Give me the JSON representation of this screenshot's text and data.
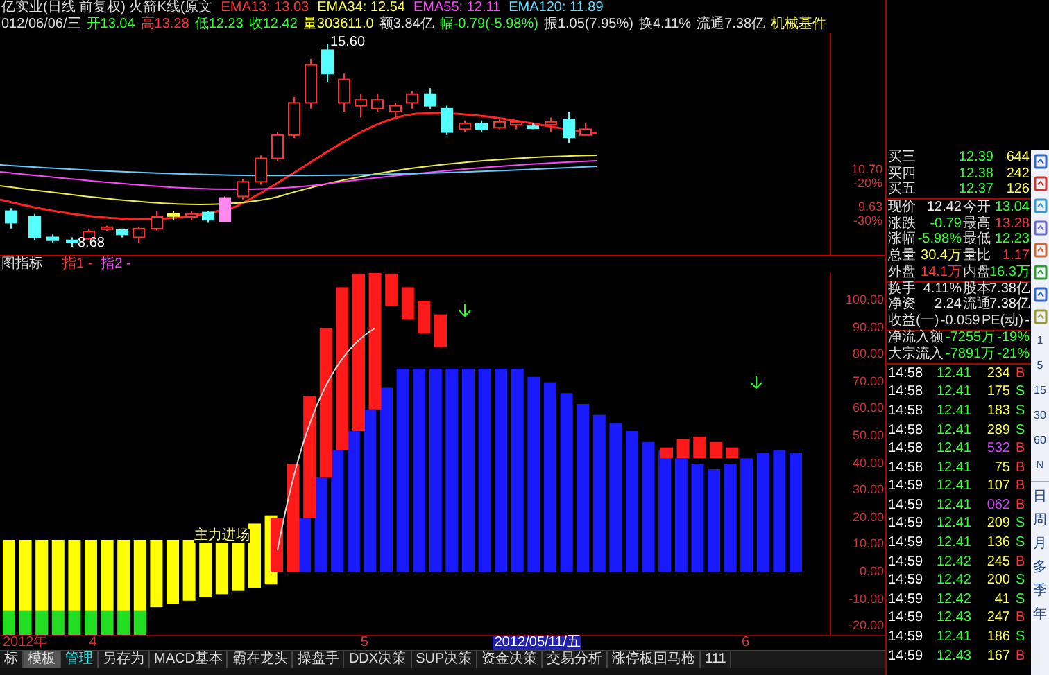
{
  "header": {
    "title": "亿实业(日线 前复权) 火箭K线(原文",
    "ema": [
      {
        "label": "EMA13: 13.03",
        "color": "#ff3333"
      },
      {
        "label": "EMA34: 12.54",
        "color": "#ffff55"
      },
      {
        "label": "EMA55: 12.11",
        "color": "#ff44ff"
      },
      {
        "label": "EMA120: 11.89",
        "color": "#66ddff"
      }
    ]
  },
  "quote_line": [
    {
      "text": "012/06/06/三",
      "color": "#dddddd"
    },
    {
      "text": "开13.04",
      "color": "#33ff33"
    },
    {
      "text": "高13.28",
      "color": "#ff3333"
    },
    {
      "text": "低12.23",
      "color": "#33ff33"
    },
    {
      "text": "收12.42",
      "color": "#33ff33"
    },
    {
      "text": "量303611.0",
      "color": "#ffff55"
    },
    {
      "text": "额3.84亿",
      "color": "#dddddd"
    },
    {
      "text": "幅-0.79(-5.98%)",
      "color": "#33ff33"
    },
    {
      "text": "振1.05(7.95%)",
      "color": "#dddddd"
    },
    {
      "text": "换4.11%",
      "color": "#dddddd"
    },
    {
      "text": "流通7.38亿",
      "color": "#dddddd"
    },
    {
      "text": "机械基件",
      "color": "#ffff55"
    }
  ],
  "price_chart": {
    "high_label": "15.60",
    "low_label": "8.68",
    "axis": [
      {
        "price": "10.70",
        "percent": "-20%"
      },
      {
        "price": "9.63",
        "percent": "-30%"
      }
    ]
  },
  "indicator": {
    "title": "图指标",
    "legend": [
      {
        "text": "指1 -",
        "color": "#ff3333"
      },
      {
        "text": "指2 -",
        "color": "#ff44ff"
      }
    ],
    "signal_label": "主力进场",
    "axis": [
      "100.00",
      "90.00",
      "80.00",
      "70.00",
      "60.00",
      "50.00",
      "40.00",
      "30.00",
      "20.00",
      "10.00",
      "0.00",
      "-10.00",
      "-20.00"
    ]
  },
  "date_axis": [
    {
      "text": "2012年",
      "selected": false
    },
    {
      "text": "4",
      "selected": false
    },
    {
      "text": "5",
      "selected": false
    },
    {
      "text": "2012/05/11/五",
      "selected": true
    },
    {
      "text": "6",
      "selected": false
    }
  ],
  "toolbar": [
    {
      "label": "标",
      "selected": false,
      "kind": "plain"
    },
    {
      "label": "模板",
      "selected": true,
      "kind": "plain"
    },
    {
      "label": "管理",
      "selected": false,
      "kind": "accent"
    },
    {
      "label": "另存为",
      "selected": false,
      "kind": "plain"
    },
    {
      "label": "MACD基本",
      "selected": false,
      "kind": "plain"
    },
    {
      "label": "霸在龙头",
      "selected": false,
      "kind": "plain"
    },
    {
      "label": "操盘手",
      "selected": false,
      "kind": "plain"
    },
    {
      "label": "DDX决策",
      "selected": false,
      "kind": "plain"
    },
    {
      "label": "SUP决策",
      "selected": false,
      "kind": "plain"
    },
    {
      "label": "资金决策",
      "selected": false,
      "kind": "plain"
    },
    {
      "label": "交易分析",
      "selected": false,
      "kind": "plain"
    },
    {
      "label": "涨停板回马枪",
      "selected": false,
      "kind": "plain"
    },
    {
      "label": "111",
      "selected": false,
      "kind": "plain"
    }
  ],
  "order_book": [
    {
      "name": "买三",
      "price": "12.39",
      "volume": "644"
    },
    {
      "name": "买四",
      "price": "12.38",
      "volume": "242"
    },
    {
      "name": "买五",
      "price": "12.37",
      "volume": "126"
    }
  ],
  "stats": [
    {
      "cells": [
        {
          "label": "现价",
          "value": "12.42",
          "color": "#eeeeee"
        },
        {
          "label": "今开",
          "value": "13.04",
          "color": "#33ff33"
        }
      ]
    },
    {
      "cells": [
        {
          "label": "涨跌",
          "value": "-0.79",
          "color": "#33ff33"
        },
        {
          "label": "最高",
          "value": "13.28",
          "color": "#ff3333"
        }
      ]
    },
    {
      "cells": [
        {
          "label": "涨幅",
          "value": "-5.98%",
          "color": "#33ff33"
        },
        {
          "label": "最低",
          "value": "12.23",
          "color": "#33ff33"
        }
      ]
    },
    {
      "cells": [
        {
          "label": "总量",
          "value": "30.4万",
          "color": "#ffff55"
        },
        {
          "label": "量比",
          "value": "1.17",
          "color": "#ff3333"
        }
      ]
    },
    {
      "cells": [
        {
          "label": "外盘",
          "value": "14.1万",
          "color": "#ff3333"
        },
        {
          "label": "内盘",
          "value": "16.3万",
          "color": "#33ff33"
        }
      ]
    },
    {
      "cells": [
        {
          "label": "换手",
          "value": "4.11%",
          "color": "#eeeeee"
        },
        {
          "label": "股本",
          "value": "7.38亿",
          "color": "#eeeeee"
        }
      ]
    },
    {
      "cells": [
        {
          "label": "净资",
          "value": "2.24",
          "color": "#eeeeee"
        },
        {
          "label": "流通",
          "value": "7.38亿",
          "color": "#eeeeee"
        }
      ]
    }
  ],
  "earnings": {
    "label": "收益(一)",
    "value": "-0.059",
    "pe_label": "PE(动)",
    "pe_value": "-"
  },
  "flows": [
    {
      "label": "净流入额",
      "value": "-7255万",
      "percent": "-19%"
    },
    {
      "label": "大宗流入",
      "value": "-7891万",
      "percent": "-21%"
    }
  ],
  "trades": [
    {
      "time": "14:58",
      "price": "12.41",
      "volume": "234",
      "big": false,
      "side": "B",
      "color": "#ff3333"
    },
    {
      "time": "14:58",
      "price": "12.41",
      "volume": "175",
      "big": false,
      "side": "S",
      "color": "#33ff33"
    },
    {
      "time": "14:58",
      "price": "12.41",
      "volume": "183",
      "big": false,
      "side": "S",
      "color": "#33ff33"
    },
    {
      "time": "14:58",
      "price": "12.41",
      "volume": "289",
      "big": false,
      "side": "S",
      "color": "#33ff33"
    },
    {
      "time": "14:58",
      "price": "12.41",
      "volume": "532",
      "big": true,
      "side": "B",
      "color": "#ff3333"
    },
    {
      "time": "14:58",
      "price": "12.41",
      "volume": "75",
      "big": false,
      "side": "B",
      "color": "#ff3333"
    },
    {
      "time": "14:59",
      "price": "12.41",
      "volume": "107",
      "big": false,
      "side": "B",
      "color": "#ff3333"
    },
    {
      "time": "14:59",
      "price": "12.41",
      "volume": "062",
      "big": true,
      "side": "B",
      "color": "#ff3333"
    },
    {
      "time": "14:59",
      "price": "12.41",
      "volume": "209",
      "big": false,
      "side": "S",
      "color": "#33ff33"
    },
    {
      "time": "14:59",
      "price": "12.41",
      "volume": "136",
      "big": false,
      "side": "S",
      "color": "#33ff33"
    },
    {
      "time": "14:59",
      "price": "12.42",
      "volume": "245",
      "big": false,
      "side": "B",
      "color": "#ff3333"
    },
    {
      "time": "14:59",
      "price": "12.42",
      "volume": "200",
      "big": false,
      "side": "S",
      "color": "#33ff33"
    },
    {
      "time": "14:59",
      "price": "12.42",
      "volume": "41",
      "big": false,
      "side": "S",
      "color": "#33ff33"
    },
    {
      "time": "14:59",
      "price": "12.43",
      "volume": "247",
      "big": false,
      "side": "B",
      "color": "#ff3333"
    },
    {
      "time": "14:59",
      "price": "12.41",
      "volume": "186",
      "big": false,
      "side": "S",
      "color": "#33ff33"
    },
    {
      "time": "14:59",
      "price": "12.43",
      "volume": "167",
      "big": false,
      "side": "B",
      "color": "#ff3333"
    }
  ],
  "periods": [
    {
      "label": "1"
    },
    {
      "label": "5"
    },
    {
      "label": "15"
    },
    {
      "label": "30"
    },
    {
      "label": "60"
    },
    {
      "label": "N"
    }
  ],
  "spans": [
    {
      "label": "日"
    },
    {
      "label": "周"
    },
    {
      "label": "月"
    },
    {
      "label": "多"
    },
    {
      "label": "季"
    },
    {
      "label": "年"
    }
  ]
}
